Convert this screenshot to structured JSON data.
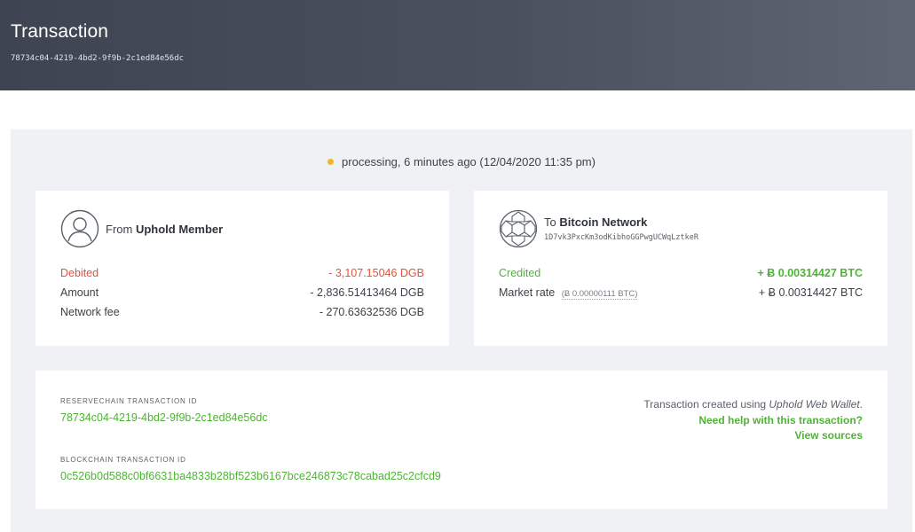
{
  "header": {
    "title": "Transaction",
    "id": "78734c04-4219-4bd2-9f9b-2c1ed84e56dc"
  },
  "status": {
    "text": "processing, 6 minutes ago (12/04/2020 11:35 pm)",
    "dot_color": "#f1b820"
  },
  "from": {
    "prefix": "From",
    "name": "Uphold Member",
    "icon": "user-avatar-icon",
    "rows": [
      {
        "label": "Debited",
        "value": "- 3,107.15046 DGB"
      },
      {
        "label": "Amount",
        "value": "- 2,836.51413464 DGB"
      },
      {
        "label": "Network fee",
        "value": "- 270.63632536 DGB"
      }
    ]
  },
  "to": {
    "prefix": "To",
    "name": "Bitcoin Network",
    "icon": "network-globe-icon",
    "address": "1D7vk3PxcKm3odKibhoGGPwgUCWqLztkeR",
    "rows": [
      {
        "label": "Credited",
        "value": "+ Ƀ 0.00314427 BTC"
      },
      {
        "label": "Market rate",
        "note": "(Ƀ 0.00000111 BTC)",
        "value": "+ Ƀ 0.00314427 BTC"
      }
    ]
  },
  "ids": {
    "reservechain_label": "RESERVECHAIN TRANSACTION ID",
    "reservechain_value": "78734c04-4219-4bd2-9f9b-2c1ed84e56dc",
    "blockchain_label": "BLOCKCHAIN TRANSACTION ID",
    "blockchain_value": "0c526b0d588c0bf6631ba4833b28bf523b6167bce246873c78cabad25c2cfcd9"
  },
  "info": {
    "created_prefix": "Transaction created using ",
    "created_app": "Uphold Web Wallet",
    "created_suffix": ".",
    "help_link": "Need help with this transaction?",
    "sources_link": "View sources"
  },
  "colors": {
    "debit": "#e0533d",
    "credit": "#4fb336",
    "header_bg": "#454b57",
    "panel_bg": "#eff1f4"
  }
}
